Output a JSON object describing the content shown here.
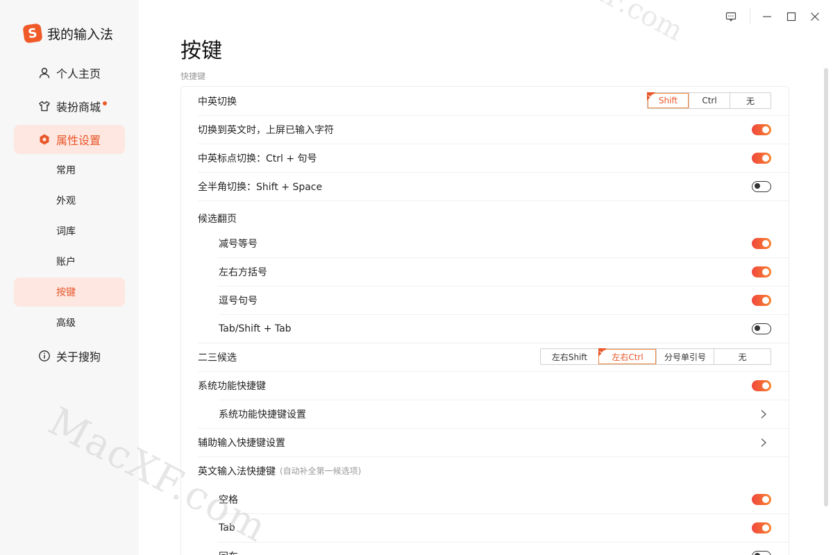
{
  "app": {
    "title": "我的输入法"
  },
  "window_controls": {
    "feedback": "feedback-icon",
    "minimize": "minimize-icon",
    "maximize": "maximize-icon",
    "close": "close-icon"
  },
  "sidebar": {
    "items": [
      {
        "label": "个人主页",
        "icon": "user-icon"
      },
      {
        "label": "装扮商城",
        "icon": "shirt-icon",
        "has_dot": true
      },
      {
        "label": "属性设置",
        "icon": "settings-hexagon-icon",
        "active": true
      },
      {
        "label": "关于搜狗",
        "icon": "info-icon"
      }
    ],
    "sub_items": [
      {
        "label": "常用"
      },
      {
        "label": "外观"
      },
      {
        "label": "词库"
      },
      {
        "label": "账户"
      },
      {
        "label": "按键",
        "active": true
      },
      {
        "label": "高级"
      }
    ]
  },
  "main": {
    "title": "按键",
    "section_label": "快捷键",
    "rows": {
      "cn_en_switch": {
        "label": "中英切换",
        "options": [
          "Shift",
          "Ctrl",
          "无"
        ],
        "selected": "Shift"
      },
      "commit_on_switch": {
        "label": "切换到英文时，上屏已输入字符",
        "on": true
      },
      "punct_switch": {
        "label": "中英标点切换：Ctrl + 句号",
        "on": true
      },
      "width_switch": {
        "label": "全半角切换：Shift + Space",
        "on": false
      },
      "page_turn": {
        "label": "候选翻页",
        "items": [
          {
            "label": "减号等号",
            "on": true
          },
          {
            "label": "左右方括号",
            "on": true
          },
          {
            "label": "逗号句号",
            "on": true
          },
          {
            "label": "Tab/Shift + Tab",
            "on": false
          }
        ]
      },
      "second_third": {
        "label": "二三候选",
        "options": [
          "左右Shift",
          "左右Ctrl",
          "分号单引号",
          "无"
        ],
        "selected": "左右Ctrl"
      },
      "sys_shortcut": {
        "label": "系统功能快捷键",
        "on": true
      },
      "sys_shortcut_settings": {
        "label": "系统功能快捷键设置"
      },
      "aux_shortcut_settings": {
        "label": "辅助输入快捷键设置"
      },
      "en_input_shortcut": {
        "label": "英文输入法快捷键",
        "hint": "(自动补全第一候选项)",
        "items": [
          {
            "label": "空格",
            "on": true
          },
          {
            "label": "Tab",
            "on": true
          },
          {
            "label": "回车",
            "on": false
          }
        ]
      }
    }
  },
  "watermark": {
    "text": "MacXF.com"
  },
  "colors": {
    "accent": "#e8562a",
    "toggle_start": "#f0473e",
    "toggle_end": "#f7852f",
    "active_bg": "#fde7e0"
  }
}
